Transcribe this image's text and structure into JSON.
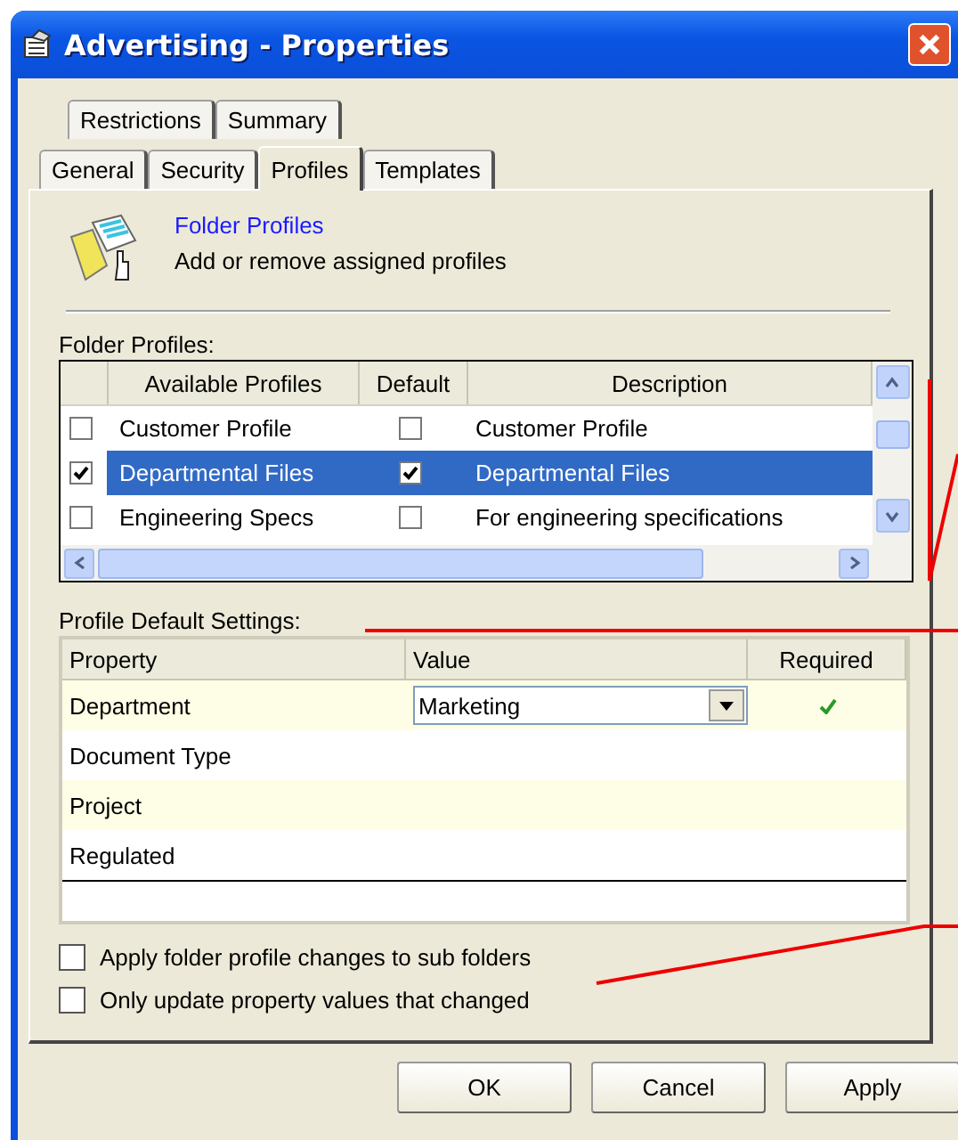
{
  "window": {
    "title": "Advertising - Properties"
  },
  "tab_rows": [
    [
      {
        "label": "Restrictions",
        "selected": false
      },
      {
        "label": "Summary",
        "selected": false
      }
    ],
    [
      {
        "label": "General",
        "selected": false
      },
      {
        "label": "Security",
        "selected": false
      },
      {
        "label": "Profiles",
        "selected": true
      },
      {
        "label": "Templates",
        "selected": false
      }
    ]
  ],
  "header": {
    "title": "Folder Profiles",
    "subtitle": "Add or remove assigned profiles"
  },
  "folder_profiles": {
    "label": "Folder Profiles:",
    "columns": [
      "Available Profiles",
      "Default",
      "Description"
    ],
    "rows": [
      {
        "checked": false,
        "name": "Customer Profile",
        "default": false,
        "description": "Customer Profile",
        "selected": false
      },
      {
        "checked": true,
        "name": "Departmental Files",
        "default": true,
        "description": "Departmental Files",
        "selected": true
      },
      {
        "checked": false,
        "name": "Engineering Specs",
        "default": false,
        "description": "For engineering specifications",
        "selected": false
      }
    ]
  },
  "profile_settings": {
    "label": "Profile Default Settings:",
    "columns": [
      "Property",
      "Value",
      "Required"
    ],
    "rows": [
      {
        "property": "Department",
        "value": "Marketing",
        "required": true
      },
      {
        "property": "Document Type",
        "required": false
      },
      {
        "property": "Project",
        "required": false
      },
      {
        "property": "Regulated",
        "required": false
      }
    ]
  },
  "options": [
    {
      "label": "Apply folder profile changes to sub folders",
      "checked": false
    },
    {
      "label": "Only update property values that changed",
      "checked": false
    }
  ],
  "buttons": [
    "OK",
    "Cancel",
    "Apply"
  ]
}
